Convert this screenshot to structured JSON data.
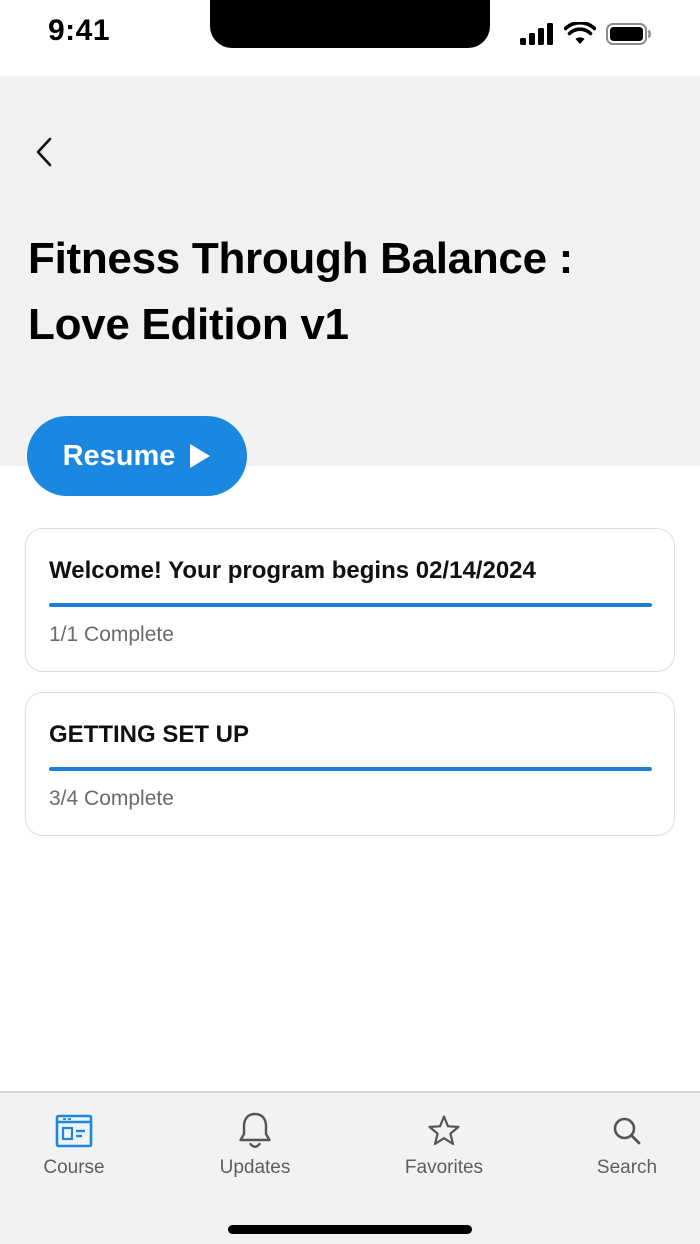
{
  "status_bar": {
    "time": "9:41"
  },
  "hero": {
    "title": "Fitness Through Balance : Love Edition v1"
  },
  "resume_button": {
    "label": "Resume"
  },
  "modules": [
    {
      "title": "Welcome! Your program begins 02/14/2024",
      "status": "1/1 Complete",
      "progress": 1.0
    },
    {
      "title": "GETTING SET UP",
      "status": "3/4 Complete",
      "progress": 1.0
    }
  ],
  "tab_bar": {
    "active": "Course",
    "items": [
      {
        "label": "Course",
        "icon": "course-icon"
      },
      {
        "label": "Updates",
        "icon": "bell-icon"
      },
      {
        "label": "Favorites",
        "icon": "star-icon"
      },
      {
        "label": "Search",
        "icon": "search-icon"
      }
    ]
  },
  "colors": {
    "accent": "#1a87e0",
    "hero_background": "#f1f1f1",
    "tab_active": "#1a87e0",
    "tab_inactive": "#5e5e5e"
  }
}
